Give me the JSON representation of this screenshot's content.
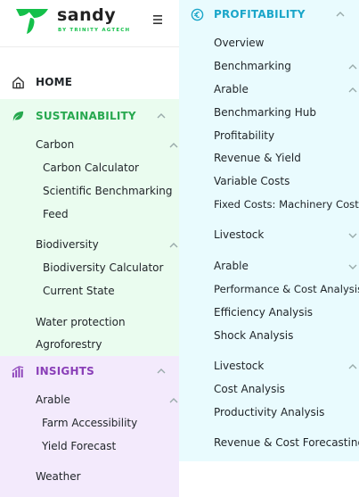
{
  "brand": {
    "name": "sandy",
    "tagline": "BY TRINITY AGTECH"
  },
  "nav": {
    "home": "HOME",
    "sustainability": {
      "title": "SUSTAINABILITY",
      "carbon": "Carbon",
      "carbon_items": [
        "Carbon Calculator",
        "Scientific Benchmarking",
        "Feed"
      ],
      "biodiversity": "Biodiversity",
      "biodiversity_items": [
        "Biodiversity Calculator",
        "Current State"
      ],
      "water": "Water protection",
      "agroforestry": "Agroforestry"
    },
    "insights": {
      "title": "INSIGHTS",
      "arable": "Arable",
      "arable_items": [
        "Farm Accessibility",
        "Yield Forecast"
      ],
      "weather": "Weather"
    }
  },
  "flyout": {
    "title": "PROFITABILITY",
    "overview": "Overview",
    "benchmarking": "Benchmarking",
    "arable": "Arable",
    "arable_items": [
      "Benchmarking Hub",
      "Profitability",
      "Revenue & Yield",
      "Variable Costs",
      "Fixed Costs: Machinery Costs"
    ],
    "livestock": "Livestock",
    "arable2": "Arable",
    "arable2_items": [
      "Performance & Cost Analysis",
      "Efficiency Analysis",
      "Shock Analysis"
    ],
    "livestock2": "Livestock",
    "livestock2_items": [
      "Cost Analysis",
      "Productivity Analysis"
    ],
    "forecasting": "Revenue & Cost Forecasting"
  },
  "colors": {
    "brand_green": "#14c04a",
    "sustainability_green": "#27a84f",
    "insights_purple": "#8a3fb8",
    "profitability_cyan": "#1aa6c9"
  },
  "icons": [
    "sandy-logo-icon",
    "hamburger-menu-icon",
    "home-icon",
    "leaf-icon",
    "insights-icon",
    "euro-circle-icon",
    "chevron-up-icon",
    "chevron-down-icon"
  ]
}
